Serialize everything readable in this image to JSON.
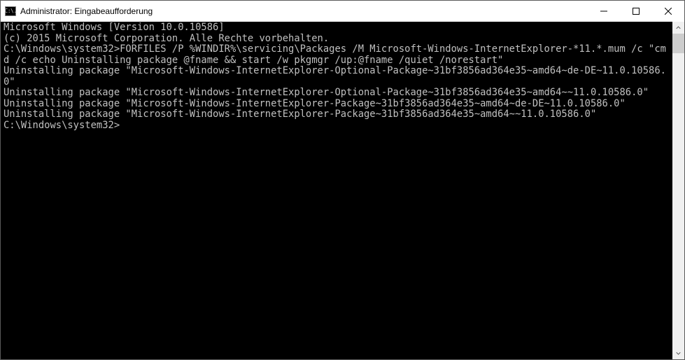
{
  "window": {
    "title": "Administrator: Eingabeaufforderung",
    "icon_text": "C:\\."
  },
  "console": {
    "line1": "Microsoft Windows [Version 10.0.10586]",
    "line2": "(c) 2015 Microsoft Corporation. Alle Rechte vorbehalten.",
    "blank1": "",
    "cmd_line": "C:\\Windows\\system32>FORFILES /P %WINDIR%\\servicing\\Packages /M Microsoft-Windows-InternetExplorer-*11.*.mum /c \"cmd /c echo Uninstalling package @fname && start /w pkgmgr /up:@fname /quiet /norestart\"",
    "blank2": "",
    "out1": "Uninstalling package \"Microsoft-Windows-InternetExplorer-Optional-Package~31bf3856ad364e35~amd64~de-DE~11.0.10586.0\"",
    "out2": "Uninstalling package \"Microsoft-Windows-InternetExplorer-Optional-Package~31bf3856ad364e35~amd64~~11.0.10586.0\"",
    "out3": "Uninstalling package \"Microsoft-Windows-InternetExplorer-Package~31bf3856ad364e35~amd64~de-DE~11.0.10586.0\"",
    "out4": "Uninstalling package \"Microsoft-Windows-InternetExplorer-Package~31bf3856ad364e35~amd64~~11.0.10586.0\"",
    "blank3": "",
    "prompt": "C:\\Windows\\system32>"
  }
}
